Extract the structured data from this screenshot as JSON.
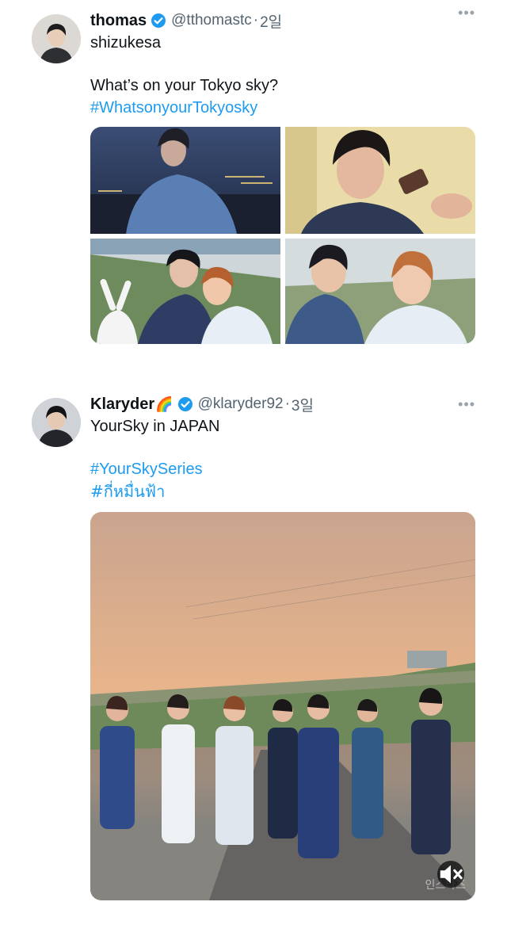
{
  "tweets": [
    {
      "name": "thomas",
      "handle": "@tthomastc",
      "separator": "·",
      "time": "2일",
      "more": "•••",
      "lines": [
        "shizukesa",
        "",
        "What’s on your Tokyo sky?"
      ],
      "hashtags": [
        "#WhatsonyourTokyosky"
      ],
      "media_type": "photo-grid-4"
    },
    {
      "name": "Klaryder",
      "name_emoji": "🌈",
      "handle": "@klaryder92",
      "separator": "·",
      "time": "3일",
      "more": "•••",
      "lines": [
        "YourSky in JAPAN"
      ],
      "hashtags": [
        "#YourSkySeries",
        "#กี่หมื่นฟ้า"
      ],
      "media_type": "video",
      "video_watermark": "인스타즈"
    }
  ],
  "icons": {
    "verified": "verified-badge-icon",
    "more": "more-icon",
    "mute": "mute-icon"
  },
  "colors": {
    "link": "#1d9bf0",
    "verified": "#1d9bf0",
    "secondary_text": "#536471"
  }
}
